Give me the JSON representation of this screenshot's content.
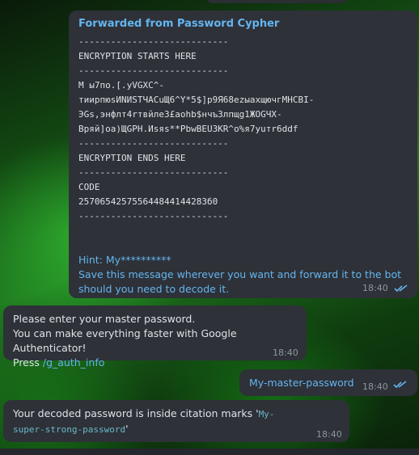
{
  "forwarded": {
    "title": "Forwarded from Password Cypher",
    "code_lines": [
      "----------------------------",
      "ENCRYPTION STARTS HERE",
      "----------------------------",
      "M ы7по.[.yVGXC^-",
      "тиирпюsИNИSТЧАСuЩ6^Y*5$]p9Я68ezыахщючгМНСВI-",
      "ЭGs,энфлт4rтвйле3£аоhb$нчъ3лпщg1ЖОGЧХ-",
      "Вряй]оа)ЩGPH.Иsяs**PbwBEU3KR^о%я7yuтr6ddf",
      "----------------------------",
      "ENCRYPTION ENDS HERE",
      "----------------------------",
      "CODE",
      "257065425755644844144283б0",
      "----------------------------"
    ],
    "hint": "Hint: My**********",
    "note": "Save this message wherever you want and forward it to the bot should you need to decode it.",
    "time": "18:40"
  },
  "bot_prompt": {
    "line1": "Please enter your master password.",
    "line2": "You can make everything faster with Google Authenticator!",
    "line3_prefix": "Press ",
    "line3_link": "/g_auth_info",
    "time": "18:40"
  },
  "user_reply": {
    "text": "My-master-password",
    "time": "18:40"
  },
  "bot_result": {
    "text_prefix": "Your decoded password is inside citation marks '",
    "password": "My-super-strong-password",
    "text_suffix": "'",
    "time": "18:40"
  },
  "colors": {
    "bubble": "#2e3138",
    "accent": "#64b5ef",
    "text": "#dfe3e8",
    "time": "#8e969e"
  }
}
